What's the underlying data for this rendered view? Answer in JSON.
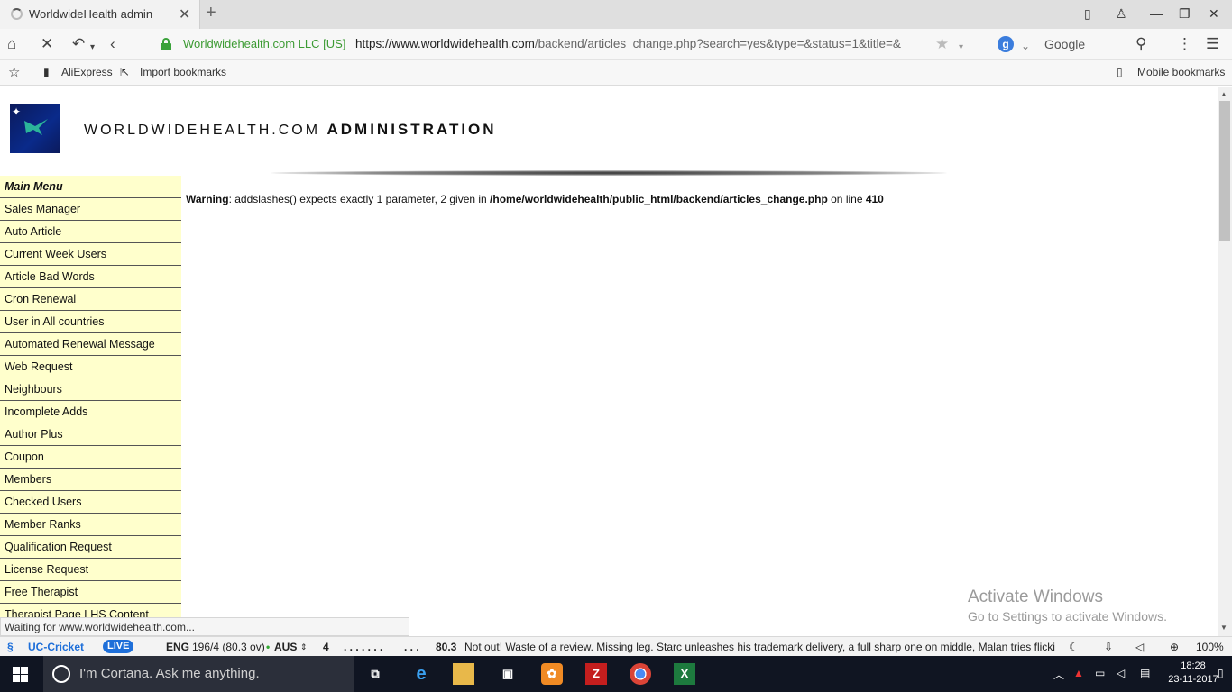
{
  "browser": {
    "tab_title": "WorldwideHealth admin",
    "org_label": "Worldwidehealth.com LLC [US]",
    "url_host": "https://www.worldwidehealth.com",
    "url_path": "/backend/articles_change.php?search=yes&type=&status=1&title=&",
    "search_engine": "Google",
    "bookmarks": [
      "AliExpress",
      "Import bookmarks"
    ],
    "mobile_bookmarks": "Mobile bookmarks"
  },
  "site": {
    "title_light": "WORLDWIDEHEALTH.COM ",
    "title_bold": "ADMINISTRATION"
  },
  "menu": {
    "heading": "Main Menu",
    "items": [
      "Sales Manager",
      "Auto Article",
      "Current Week Users",
      "Article Bad Words",
      "Cron Renewal",
      "User in All countries",
      "Automated Renewal Message",
      "Web Request",
      "Neighbours",
      "Incomplete Adds",
      "Author Plus",
      "Coupon",
      "Members",
      "Checked Users",
      "Member Ranks",
      "Qualification Request",
      "License Request",
      "Free Therapist",
      "Therapist Page LHS Content"
    ]
  },
  "warning": {
    "label": "Warning",
    "message": ": addslashes() expects exactly 1 parameter, 2 given in ",
    "path": "/home/worldwidehealth/public_html/backend/articles_change.php",
    "online": " on line ",
    "line": "410"
  },
  "watermark": {
    "line1": "Activate Windows",
    "line2": "Go to Settings to activate Windows."
  },
  "status": "Waiting for www.worldwidehealth.com...",
  "ticker": {
    "brand": "UC-Cricket",
    "live": "LIVE",
    "eng": "ENG",
    "score": "196/4 (80.3 ov)",
    "aus": "AUS",
    "four": "4",
    "dots": ". . . . . . .",
    "dots2": ". . .",
    "over": "80.3",
    "news": "Not out! Waste of a review. Missing leg. Starc unleashes his trademark delivery, a full sharp one on middle, Malan tries flickin",
    "zoom": "100%"
  },
  "taskbar": {
    "cortana": "I'm Cortana. Ask me anything.",
    "time": "18:28",
    "date": "23-11-2017"
  }
}
